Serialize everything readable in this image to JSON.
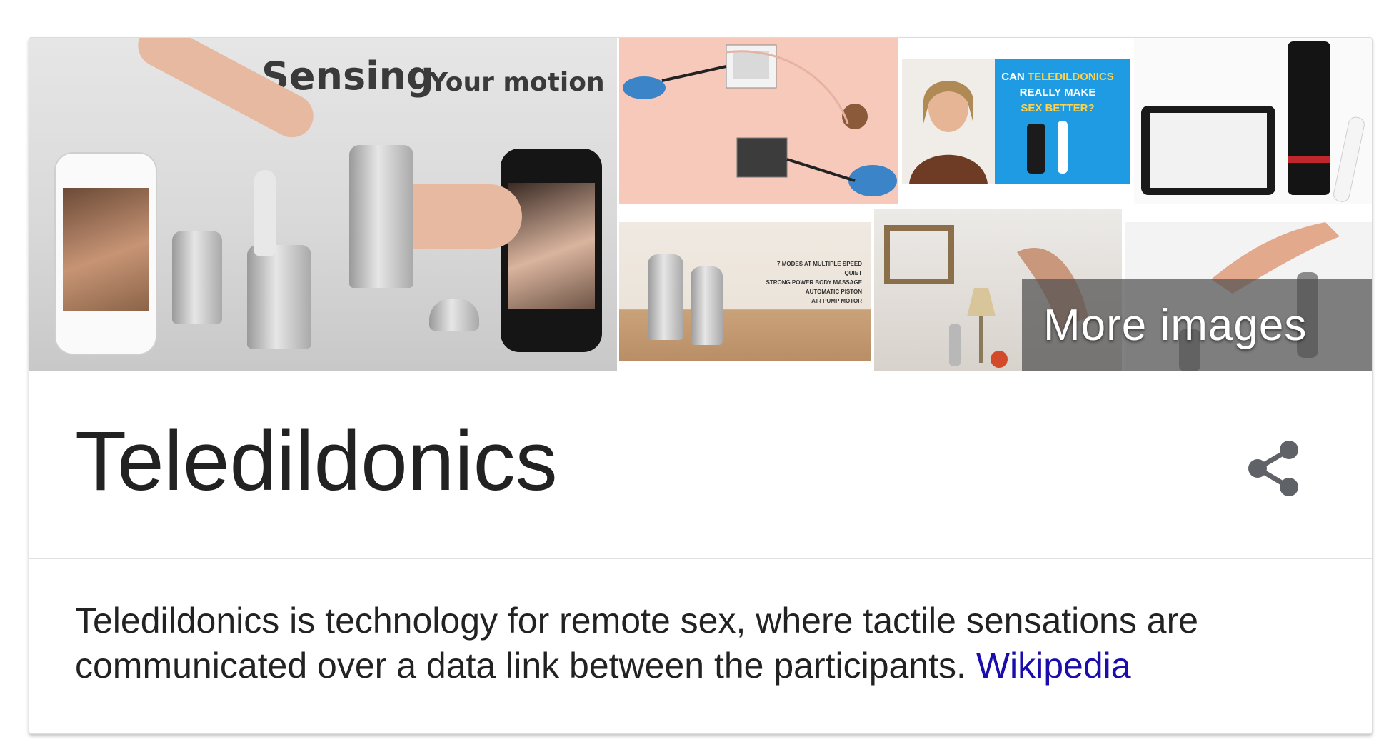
{
  "gallery": {
    "main_caption_big": "Sensing",
    "main_caption_small": "Your motion",
    "video_title_prefix": "CAN",
    "video_title_highlight": "TELEDILDONICS",
    "video_title_rest": "REALLY MAKE",
    "video_title_end": "SEX BETTER?",
    "more_images_label": "More images"
  },
  "entity": {
    "title": "Teledildonics",
    "description": "Teledildonics is technology for remote sex, where tactile sensations are communicated over a data link between the participants.",
    "source_link": "Wikipedia"
  },
  "icons": {
    "share": "share-icon"
  },
  "colors": {
    "link": "#1a0dab",
    "title": "#222222",
    "overlay": "rgba(80,80,80,0.72)"
  }
}
